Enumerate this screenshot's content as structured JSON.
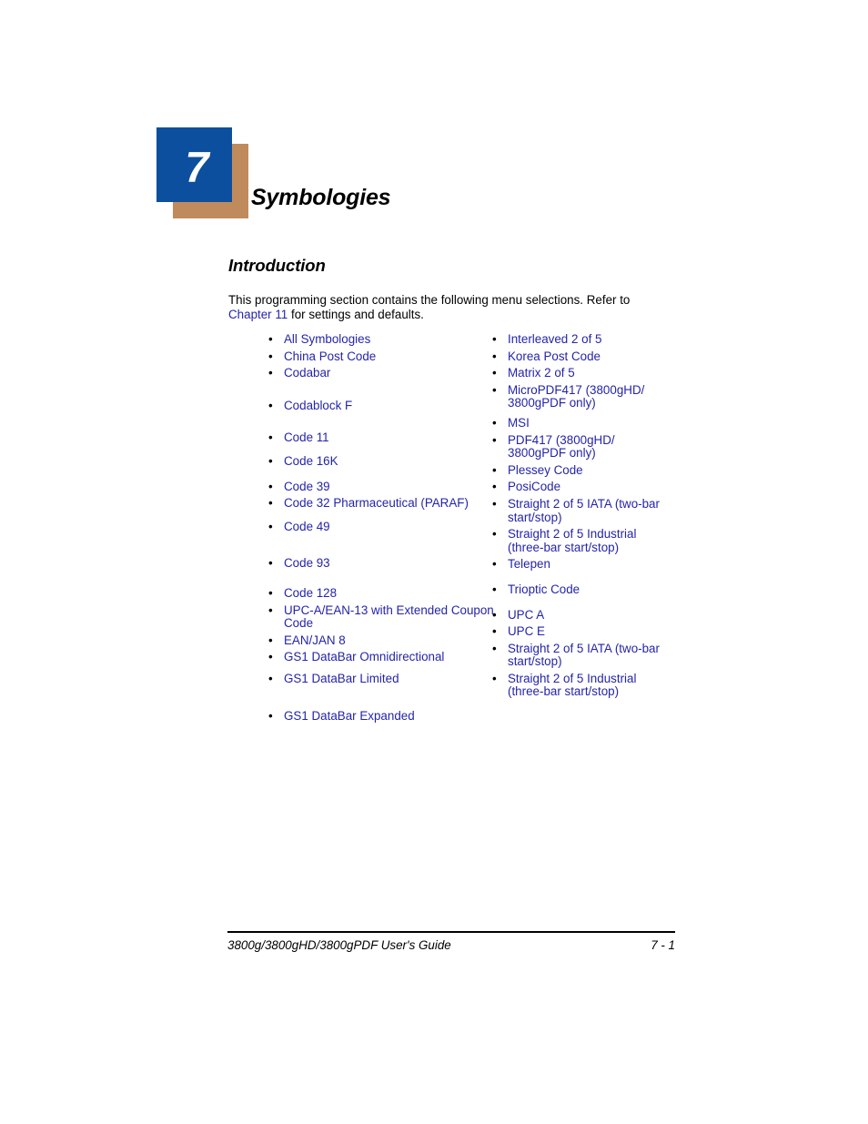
{
  "chapter": {
    "number": "7",
    "title": "Symbologies",
    "badge_blue": "#0b4f9e",
    "badge_tan": "#c08b5c"
  },
  "section": {
    "heading": "Introduction",
    "paragraph_before_link": "This programming section contains the following menu selections.  Refer to ",
    "paragraph_link": "Chapter 11",
    "paragraph_after_link": " for settings and defaults."
  },
  "link_color": "#2424ab",
  "columns": {
    "left": [
      {
        "label": "All Symbologies",
        "gap_after": 4
      },
      {
        "label": "China Post Code",
        "gap_after": 4
      },
      {
        "label": "Codabar",
        "gap_after": 21
      },
      {
        "label": "Codablock F",
        "gap_after": 21
      },
      {
        "label": "Code 11",
        "gap_after": 11
      },
      {
        "label": "Code 16K",
        "gap_after": 13
      },
      {
        "label": "Code 39",
        "gap_after": 4
      },
      {
        "label": "Code 32 Pharmaceutical (PARAF)",
        "gap_after": 11
      },
      {
        "label": "Code 49",
        "gap_after": 26
      },
      {
        "label": "Code 93",
        "gap_after": 18
      },
      {
        "label": "Code 128",
        "gap_after": 4
      },
      {
        "label": "UPC-A/EAN-13 with Extended Coupon Code",
        "gap_after": 4
      },
      {
        "label": "EAN/JAN 8",
        "gap_after": 4
      },
      {
        "label": "GS1 DataBar Omnidirectional",
        "gap_after": 9
      },
      {
        "label": "GS1 DataBar Limited",
        "gap_after": 26
      },
      {
        "label": "GS1 DataBar Expanded",
        "gap_after": 0
      }
    ],
    "right": [
      {
        "label": "Interleaved 2 of 5",
        "gap_after": 4
      },
      {
        "label": "Korea Post Code",
        "gap_after": 4
      },
      {
        "label": "Matrix 2 of 5",
        "gap_after": 4
      },
      {
        "label": "MicroPDF417 (3800gHD/ 3800gPDF only)",
        "gap_after": 7
      },
      {
        "label": "MSI",
        "gap_after": 4
      },
      {
        "label": "PDF417 (3800gHD/ 3800gPDF only)",
        "gap_after": 4
      },
      {
        "label": "Plessey Code",
        "gap_after": 4
      },
      {
        "label": "PosiCode",
        "gap_after": 4
      },
      {
        "label": "Straight 2 of 5 IATA (two-bar start/stop)",
        "gap_after": 4
      },
      {
        "label": "Straight 2 of 5 Industrial (three-bar start/stop)",
        "gap_after": 4
      },
      {
        "label": "Telepen",
        "gap_after": 13
      },
      {
        "label": "Trioptic Code",
        "gap_after": 13
      },
      {
        "label": "UPC A",
        "gap_after": 4
      },
      {
        "label": "UPC E",
        "gap_after": 4
      },
      {
        "label": "Straight 2 of 5 IATA (two-bar start/stop)",
        "gap_after": 4
      },
      {
        "label": "Straight 2 of 5 Industrial (three-bar start/stop)",
        "gap_after": 0
      }
    ]
  },
  "footer": {
    "guide_title": "3800g/3800gHD/3800gPDF User's Guide",
    "page_number": "7 - 1"
  },
  "icons": {
    "bullet": "•"
  }
}
